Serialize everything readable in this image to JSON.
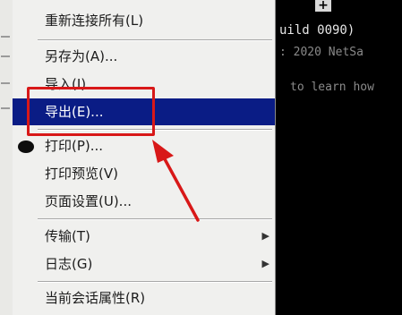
{
  "menu": {
    "items": [
      {
        "label": "重新连接所有(L)",
        "submenu": false
      },
      {
        "label": "另存为(A)...",
        "submenu": false
      },
      {
        "label": "导入(I)...",
        "submenu": false
      },
      {
        "label": "导出(E)...",
        "submenu": false,
        "highlighted": true
      },
      {
        "label": "打印(P)...",
        "submenu": false,
        "icon": "printer-icon"
      },
      {
        "label": "打印预览(V)",
        "submenu": false
      },
      {
        "label": "页面设置(U)...",
        "submenu": false
      },
      {
        "label": "传输(T)",
        "submenu": true
      },
      {
        "label": "日志(G)",
        "submenu": true
      },
      {
        "label": "当前会话属性(R)",
        "submenu": false
      }
    ],
    "highlight_color": "#0a1c85"
  },
  "annotation": {
    "color": "#d81818"
  },
  "terminal": {
    "new_tab_label": "+",
    "line1": "uild 0090)",
    "line2": ": 2020 NetSa",
    "line3": "to learn how"
  }
}
